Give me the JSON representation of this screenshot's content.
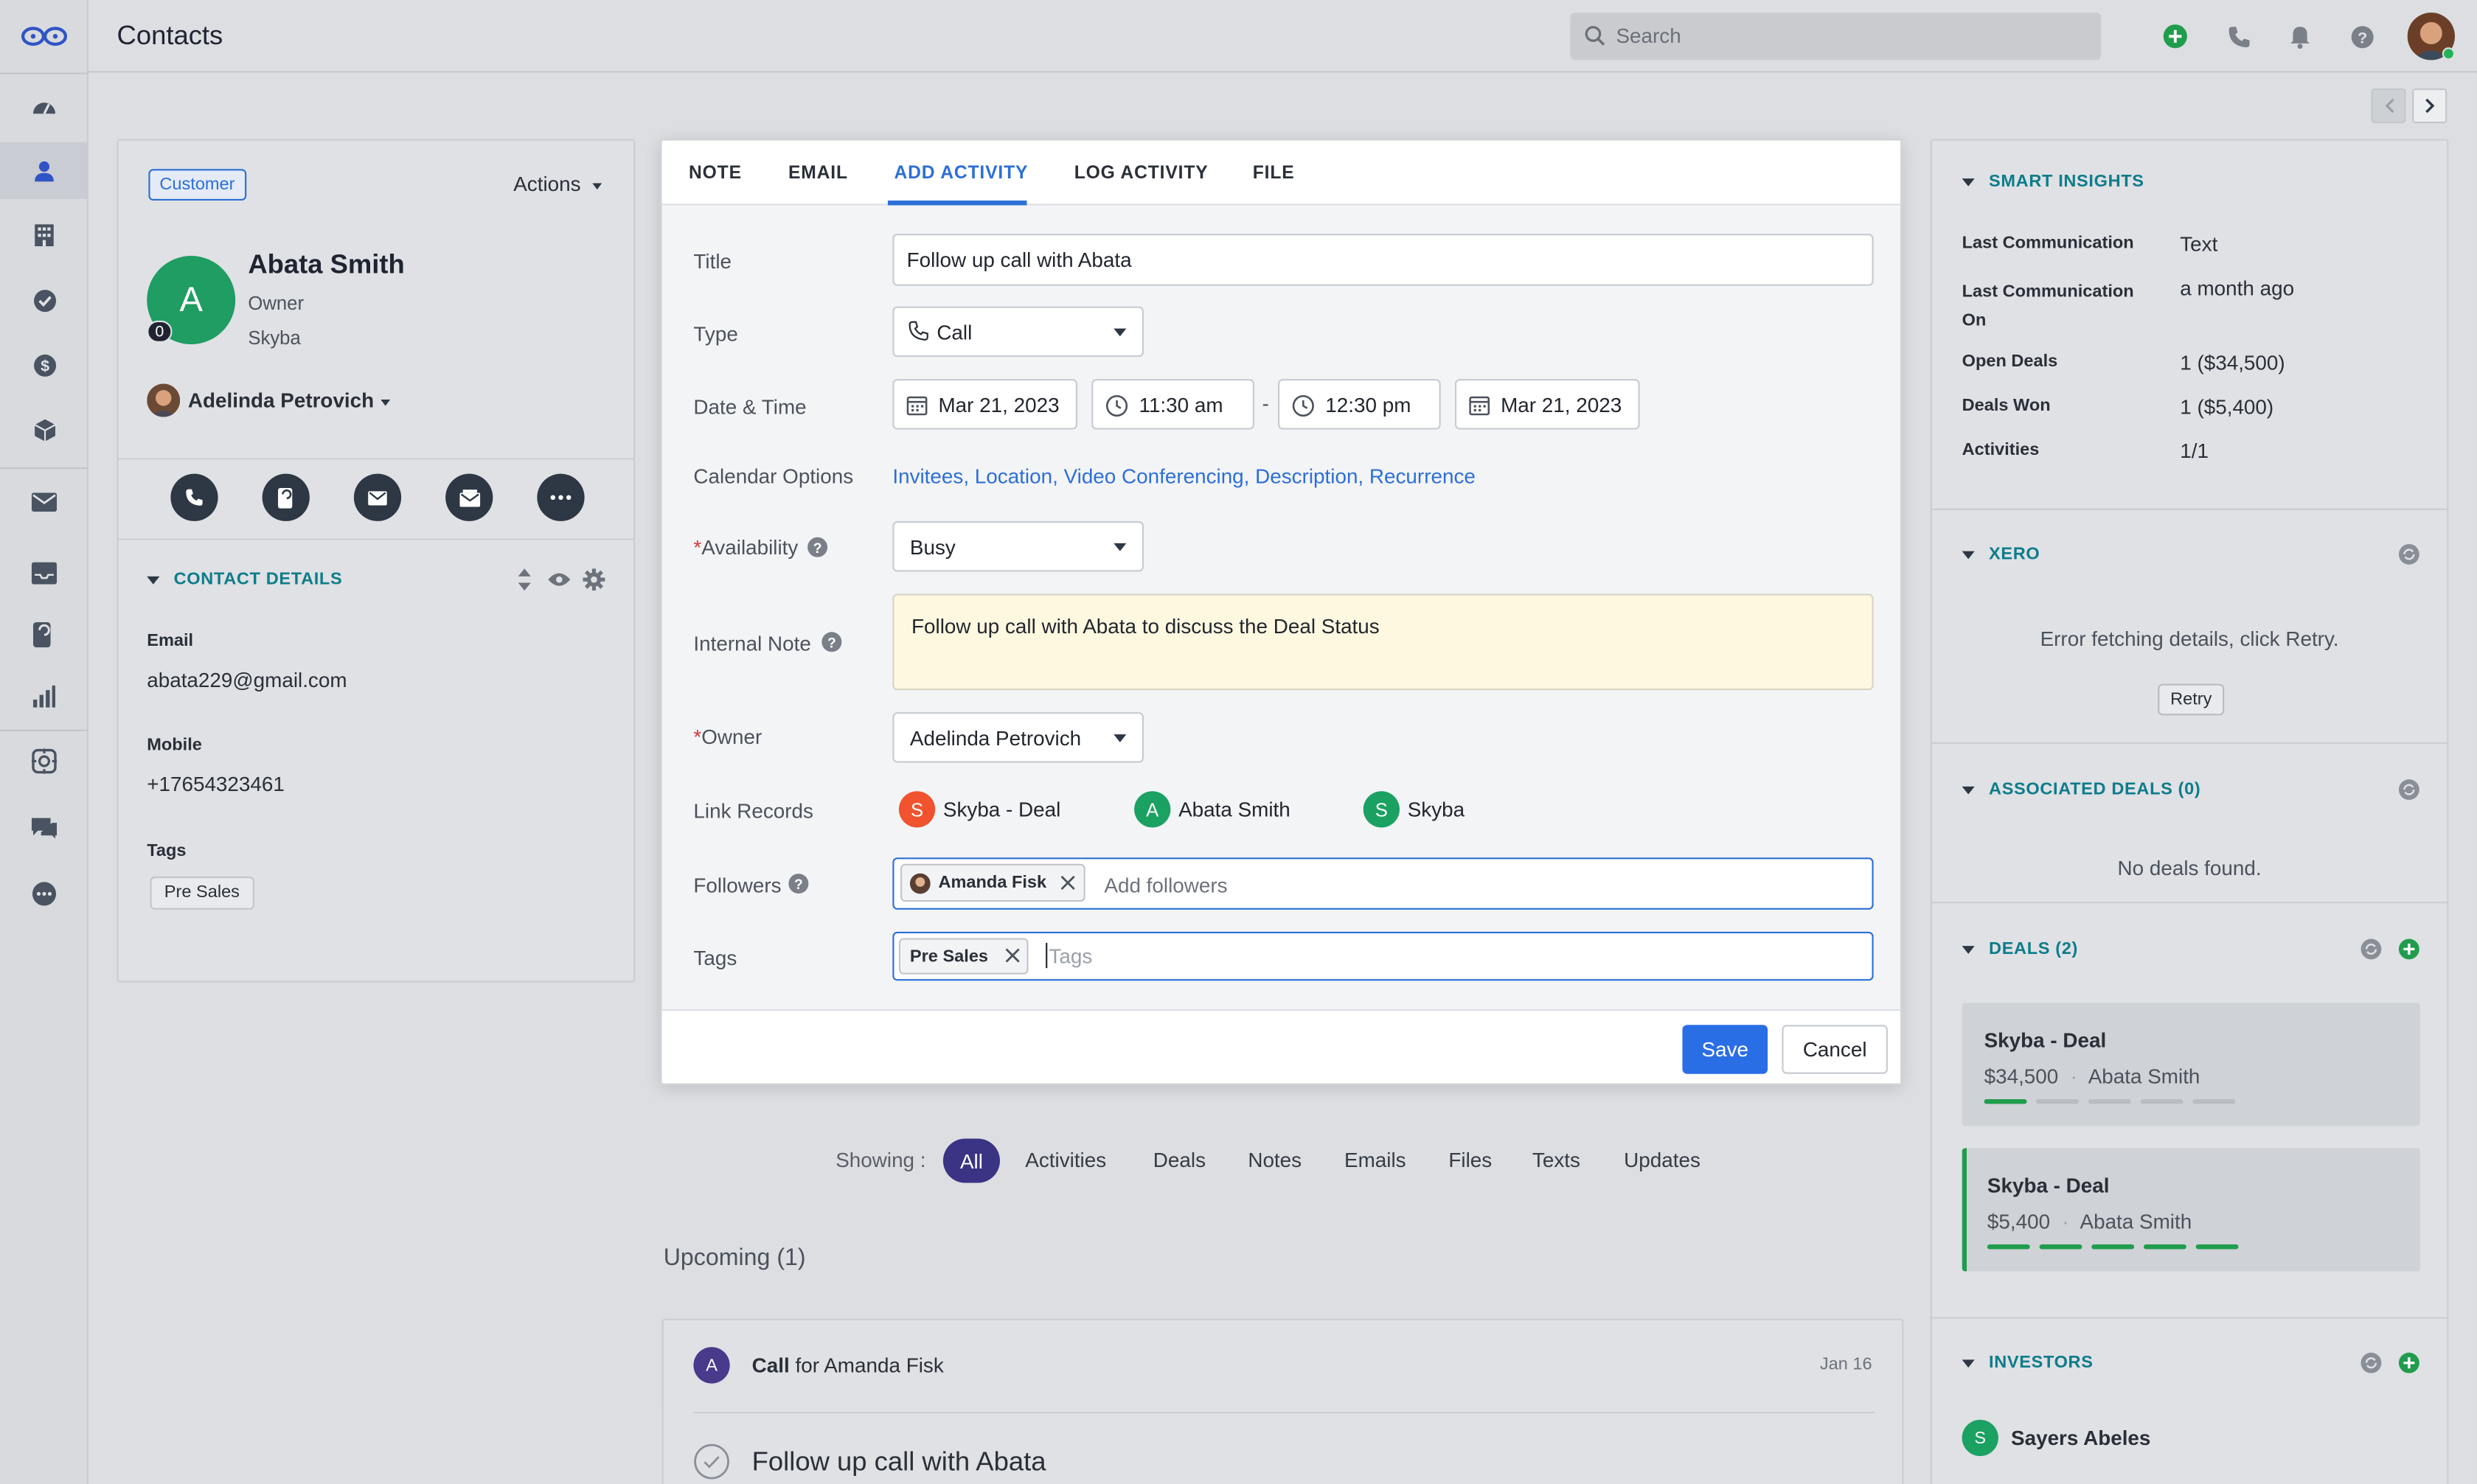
{
  "app": {
    "page_title": "Contacts",
    "search_placeholder": "Search"
  },
  "contact": {
    "type_badge": "Customer",
    "actions_label": "Actions",
    "avatar_letter": "A",
    "avatar_count": "0",
    "name": "Abata Smith",
    "role": "Owner",
    "company": "Skyba",
    "owner_name": "Adelinda Petrovich",
    "details_heading": "CONTACT DETAILS",
    "email_label": "Email",
    "email": "abata229@gmail.com",
    "mobile_label": "Mobile",
    "mobile": "+17654323461",
    "tags_label": "Tags",
    "tag": "Pre Sales"
  },
  "tabs": [
    "NOTE",
    "EMAIL",
    "ADD ACTIVITY",
    "LOG ACTIVITY",
    "FILE"
  ],
  "form": {
    "title_label": "Title",
    "title_value": "Follow up call with Abata",
    "type_label": "Type",
    "type_value": "Call",
    "datetime_label": "Date & Time",
    "start_date": "Mar 21, 2023",
    "start_time": "11:30 am",
    "dash": "-",
    "end_time": "12:30 pm",
    "end_date": "Mar 21, 2023",
    "calendar_label": "Calendar Options",
    "calendar_options": "Invitees, Location, Video Conferencing, Description, Recurrence",
    "availability_req": "*",
    "availability_label": "Availability",
    "availability_value": "Busy",
    "note_label": "Internal Note",
    "note_value": "Follow up call with Abata to discuss the Deal Status",
    "owner_req": "*",
    "owner_label": "Owner",
    "owner_value": "Adelinda Petrovich",
    "link_label": "Link Records",
    "links": [
      {
        "letter": "S",
        "name": "Skyba - Deal",
        "color": "#f0532e"
      },
      {
        "letter": "A",
        "name": "Abata Smith",
        "color": "#1ba162"
      },
      {
        "letter": "S",
        "name": "Skyba",
        "color": "#1ba162"
      }
    ],
    "followers_label": "Followers",
    "follower_chip": "Amanda Fisk",
    "followers_placeholder": "Add followers",
    "tags_label": "Tags",
    "tag_chip": "Pre Sales",
    "tags_placeholder": "Tags",
    "save": "Save",
    "cancel": "Cancel"
  },
  "filters": {
    "label": "Showing :",
    "items": [
      "All",
      "Activities",
      "Deals",
      "Notes",
      "Emails",
      "Files",
      "Texts",
      "Updates"
    ]
  },
  "timeline": {
    "upcoming": "Upcoming (1)",
    "item_avatar": "A",
    "item_type": "Call",
    "item_rest": "for Amanda Fisk",
    "item_date": "Jan 16",
    "item_title": "Follow up call with Abata"
  },
  "insights": {
    "heading": "SMART INSIGHTS",
    "rows": [
      {
        "label": "Last Communication",
        "value": "Text"
      },
      {
        "label": "Last Communication On",
        "value": "a month ago"
      },
      {
        "label": "Open Deals",
        "value": "1 ($34,500)"
      },
      {
        "label": "Deals Won",
        "value": "1 ($5,400)"
      },
      {
        "label": "Activities",
        "value": "1/1"
      }
    ]
  },
  "xero": {
    "heading": "XERO",
    "message": "Error fetching details, click Retry.",
    "retry": "Retry"
  },
  "associated": {
    "heading": "ASSOCIATED DEALS (0)",
    "empty": "No deals found."
  },
  "deals": {
    "heading": "DEALS (2)",
    "items": [
      {
        "name": "Skyba - Deal",
        "amount": "$34,500",
        "contact": "Abata Smith",
        "stages_done": 1,
        "stages_total": 5
      },
      {
        "name": "Skyba - Deal",
        "amount": "$5,400",
        "contact": "Abata Smith",
        "stages_done": 5,
        "stages_total": 5
      }
    ]
  },
  "investors": {
    "heading": "INVESTORS",
    "avatar": "S",
    "name": "Sayers Abeles"
  },
  "colors": {
    "primary": "#2a6ee6",
    "teal": "#0e7c8a",
    "green": "#1f9d4c",
    "tab_active": "#2c6fd6"
  }
}
